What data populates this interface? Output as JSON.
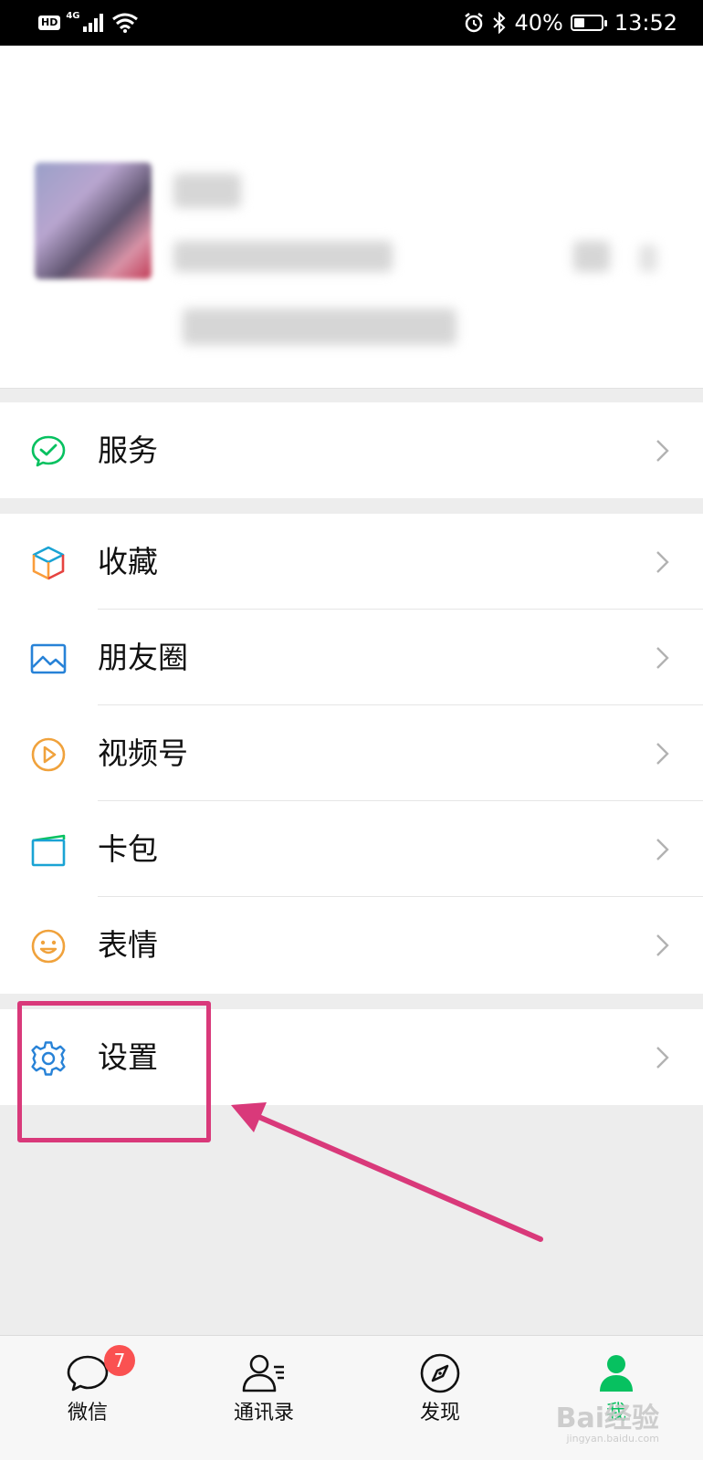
{
  "status_bar": {
    "hd": "HD",
    "network": "4G",
    "battery_percent_text": "40%",
    "battery_level": 0.4,
    "time": "13:52"
  },
  "profile": {
    "icons": [
      "avatar"
    ]
  },
  "menu_groups": [
    {
      "items": [
        {
          "label": "服务",
          "icon": "wechat-pay-icon",
          "color": "#07c160"
        }
      ]
    },
    {
      "items": [
        {
          "label": "收藏",
          "icon": "favorites-cube-icon",
          "color": "#fa9d3b"
        },
        {
          "label": "朋友圈",
          "icon": "moments-picture-icon",
          "color": "#2782d7"
        },
        {
          "label": "视频号",
          "icon": "channels-play-icon",
          "color": "#f0a23c"
        },
        {
          "label": "卡包",
          "icon": "card-wallet-icon",
          "color": "#1aa3d4"
        },
        {
          "label": "表情",
          "icon": "sticker-smile-icon",
          "color": "#f0a23c"
        }
      ]
    },
    {
      "items": [
        {
          "label": "设置",
          "icon": "settings-gear-icon",
          "color": "#2782d7"
        }
      ]
    }
  ],
  "annotation": {
    "color": "#d9397a"
  },
  "tab_bar": {
    "tabs": [
      {
        "label": "微信",
        "icon": "chat-bubble-icon",
        "badge": "7",
        "active": false
      },
      {
        "label": "通讯录",
        "icon": "contacts-icon",
        "active": false
      },
      {
        "label": "发现",
        "icon": "compass-icon",
        "active": false
      },
      {
        "label": "我",
        "icon": "me-person-icon",
        "active": true
      }
    ],
    "active_color": "#07c160"
  },
  "watermark": {
    "main": "Bai经验",
    "sub": "jingyan.baidu.com"
  }
}
